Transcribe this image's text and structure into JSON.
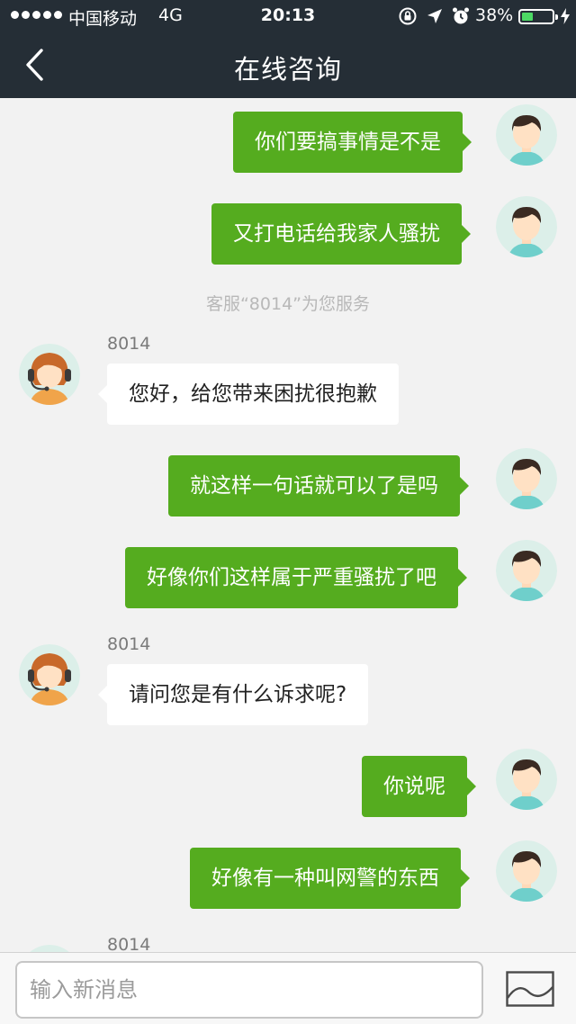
{
  "status_bar": {
    "carrier": "中国移动",
    "network": "4G",
    "time": "20:13",
    "battery_percent": "38%",
    "battery_level": 0.38,
    "icons": [
      "signal-dots-icon",
      "rotation-lock-icon",
      "location-arrow-icon",
      "alarm-clock-icon",
      "battery-icon",
      "charging-bolt-icon"
    ]
  },
  "header": {
    "title": "在线咨询",
    "back_icon": "chevron-left-icon"
  },
  "conversation": {
    "agent_name": "8014",
    "system_note": "客服“8014”为您服务",
    "messages": [
      {
        "from": "user",
        "text": "你们要搞事情是不是"
      },
      {
        "from": "user",
        "text": "又打电话给我家人骚扰"
      },
      {
        "from": "agent",
        "sender": "8014",
        "text": "您好，给您带来困扰很抱歉"
      },
      {
        "from": "user",
        "text": "就这样一句话就可以了是吗"
      },
      {
        "from": "user",
        "text": "好像你们这样属于严重骚扰了吧"
      },
      {
        "from": "agent",
        "sender": "8014",
        "text": "请问您是有什么诉求呢?"
      },
      {
        "from": "user",
        "text": "你说呢"
      },
      {
        "from": "user",
        "text": "好像有一种叫网警的东西"
      },
      {
        "from": "agent",
        "sender": "8014",
        "text": ""
      }
    ]
  },
  "input_bar": {
    "placeholder": "输入新消息",
    "value": "",
    "image_button_icon": "image-picture-icon"
  },
  "colors": {
    "header_bg": "#252e36",
    "page_bg": "#f2f2f2",
    "user_bubble": "#55ac1f",
    "agent_bubble": "#ffffff",
    "battery_fill": "#4cd964"
  }
}
